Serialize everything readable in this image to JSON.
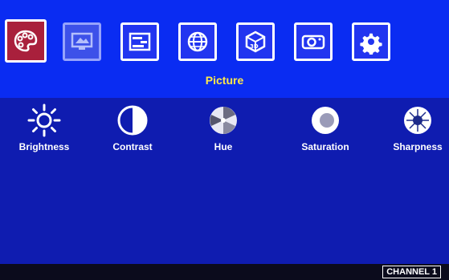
{
  "menu": {
    "tabs": [
      {
        "name": "picture",
        "icon": "palette-icon",
        "active": true
      },
      {
        "name": "display",
        "icon": "monitor-icon",
        "active": false
      },
      {
        "name": "adjust",
        "icon": "sliders-icon",
        "active": false
      },
      {
        "name": "network",
        "icon": "globe-icon",
        "active": false
      },
      {
        "name": "3d",
        "icon": "3d-cube-icon",
        "active": false
      },
      {
        "name": "projector",
        "icon": "projector-icon",
        "active": false
      },
      {
        "name": "settings",
        "icon": "gear-icon",
        "active": false
      }
    ],
    "title": "Picture"
  },
  "picture": {
    "items": [
      {
        "label": "Brightness",
        "icon": "sun-icon"
      },
      {
        "label": "Contrast",
        "icon": "contrast-icon"
      },
      {
        "label": "Hue",
        "icon": "hue-wheel-icon"
      },
      {
        "label": "Saturation",
        "icon": "saturation-icon"
      },
      {
        "label": "Sharpness",
        "icon": "sharpness-icon"
      }
    ]
  },
  "status": {
    "channel": "CHANNEL 1"
  },
  "colors": {
    "background": "#0f1cb0",
    "top_bar": "#0a2cf2",
    "active_tab": "#a9203c",
    "title": "#ffe94a",
    "status_bar": "#0b0b1c"
  }
}
